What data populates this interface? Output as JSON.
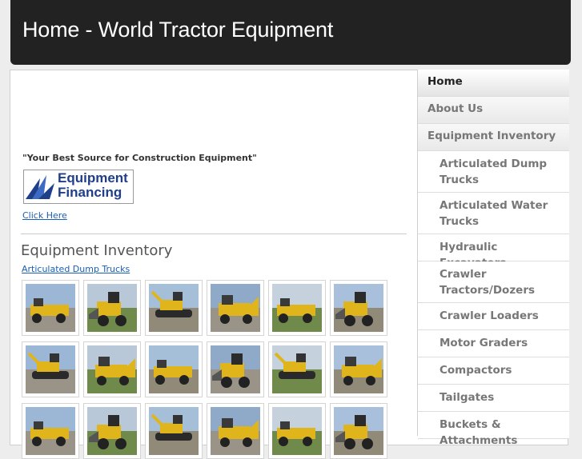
{
  "header": {
    "title": "Home - World Tractor Equipment"
  },
  "main": {
    "tagline": "\"Your Best Source for Construction Equipment\"",
    "financing_logo": {
      "line1": "Equipment",
      "line2": "Financing",
      "brand_color": "#1f3f8a"
    },
    "click_here": "Click Here",
    "section_title": "Equipment Inventory",
    "subsection_link": "Articulated Dump Trucks",
    "thumbnails": [
      "lineup-of-yellow-dump-trucks",
      "yellow-wheel-loader",
      "yellow-excavators-yard",
      "articulated-dump-truck",
      "loader-dumping-gravel",
      "yellow-crawler-dozer",
      "yellow-motor-grader",
      "large-wheel-loader",
      "equipment-scrap-yard",
      "row-of-dump-trucks",
      "articulated-water-truck",
      "motor-grader-side",
      "loader-front",
      "wheel-loader-bucket",
      "excavator-cab",
      "excavator-arm",
      "excavator-front",
      "excavator-on-pad"
    ]
  },
  "sidebar": {
    "items": [
      {
        "label": "Home",
        "level": "top",
        "active": true
      },
      {
        "label": "About Us",
        "level": "top"
      },
      {
        "label": "Equipment Inventory",
        "level": "top"
      },
      {
        "label": "Articulated Dump Trucks",
        "level": "sub"
      },
      {
        "label": "Articulated Water Trucks",
        "level": "sub"
      },
      {
        "label": "Hydraulic Excavators",
        "level": "sub"
      },
      {
        "label": "Crawler Tractors/Dozers",
        "level": "sub"
      },
      {
        "label": "Crawler Loaders",
        "level": "sub"
      },
      {
        "label": "Motor Graders",
        "level": "sub"
      },
      {
        "label": "Compactors",
        "level": "sub"
      },
      {
        "label": "Tailgates",
        "level": "sub"
      },
      {
        "label": "Buckets & Attachments",
        "level": "sub"
      }
    ]
  },
  "colors": {
    "header_bg": "#222222",
    "link": "#1a5fb4",
    "machine_yellow": "#e0b51c"
  }
}
